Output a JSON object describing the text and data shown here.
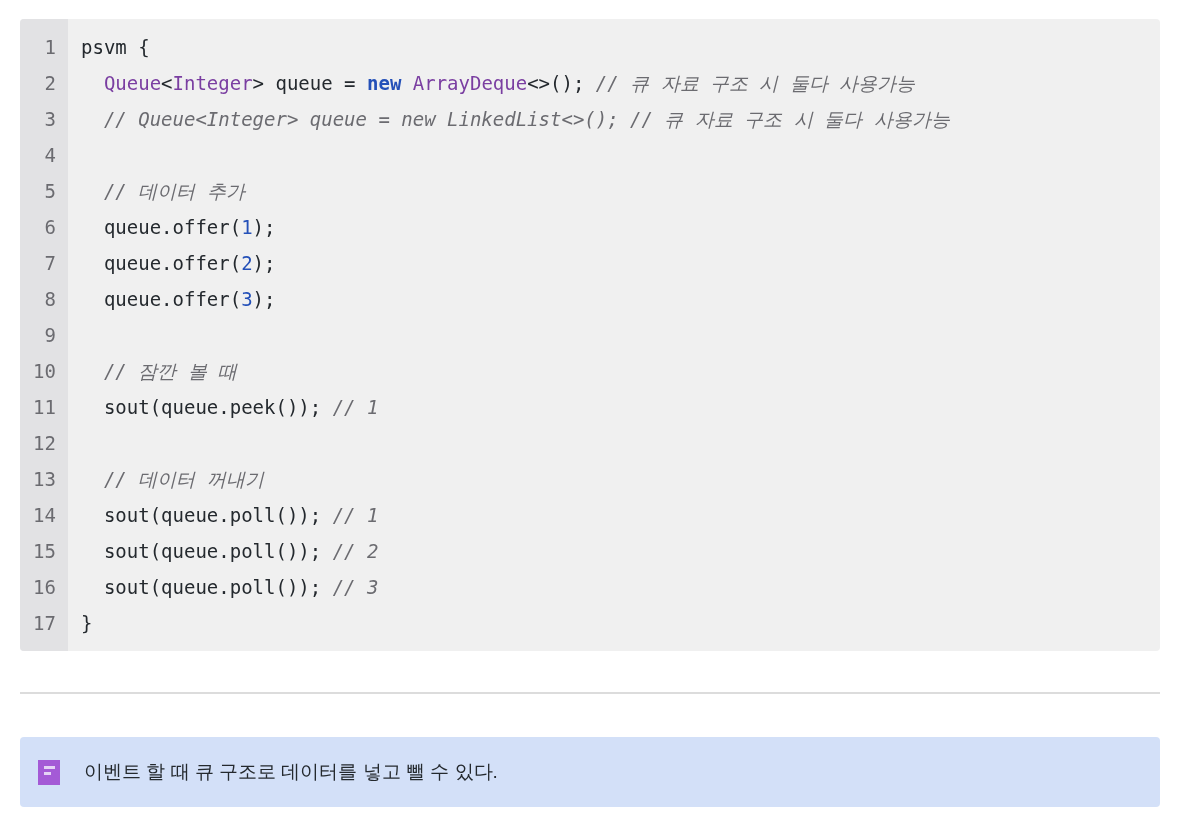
{
  "code_block": {
    "lines": [
      {
        "number": "1",
        "tokens": [
          {
            "kind": "plain",
            "text": "psvm {"
          }
        ]
      },
      {
        "number": "2",
        "tokens": [
          {
            "kind": "type",
            "text": "  Queue"
          },
          {
            "kind": "plain",
            "text": "<"
          },
          {
            "kind": "type",
            "text": "Integer"
          },
          {
            "kind": "plain",
            "text": "> queue = "
          },
          {
            "kind": "keyword",
            "text": "new"
          },
          {
            "kind": "type",
            "text": " ArrayDeque"
          },
          {
            "kind": "plain",
            "text": "<>(); "
          },
          {
            "kind": "comment",
            "text": "// 큐 자료 구조 시 둘다 사용가능"
          }
        ]
      },
      {
        "number": "3",
        "tokens": [
          {
            "kind": "comment",
            "text": "  // Queue<Integer> queue = new LinkedList<>(); // 큐 자료 구조 시 둘다 사용가능"
          }
        ]
      },
      {
        "number": "4"
      },
      {
        "number": "5",
        "tokens": [
          {
            "kind": "comment",
            "text": "  // 데이터 추가"
          }
        ]
      },
      {
        "number": "6",
        "tokens": [
          {
            "kind": "plain",
            "text": "  queue.offer("
          },
          {
            "kind": "number",
            "text": "1"
          },
          {
            "kind": "plain",
            "text": ");"
          }
        ]
      },
      {
        "number": "7",
        "tokens": [
          {
            "kind": "plain",
            "text": "  queue.offer("
          },
          {
            "kind": "number",
            "text": "2"
          },
          {
            "kind": "plain",
            "text": ");"
          }
        ]
      },
      {
        "number": "8",
        "tokens": [
          {
            "kind": "plain",
            "text": "  queue.offer("
          },
          {
            "kind": "number",
            "text": "3"
          },
          {
            "kind": "plain",
            "text": ");"
          }
        ]
      },
      {
        "number": "9"
      },
      {
        "number": "10",
        "tokens": [
          {
            "kind": "comment",
            "text": "  // 잠깐 볼 때"
          }
        ]
      },
      {
        "number": "11",
        "tokens": [
          {
            "kind": "plain",
            "text": "  sout(queue.peek()); "
          },
          {
            "kind": "comment",
            "text": "// 1"
          }
        ]
      },
      {
        "number": "12"
      },
      {
        "number": "13",
        "tokens": [
          {
            "kind": "comment",
            "text": "  // 데이터 꺼내기"
          }
        ]
      },
      {
        "number": "14",
        "tokens": [
          {
            "kind": "plain",
            "text": "  sout(queue.poll()); "
          },
          {
            "kind": "comment",
            "text": "// 1"
          }
        ]
      },
      {
        "number": "15",
        "tokens": [
          {
            "kind": "plain",
            "text": "  sout(queue.poll()); "
          },
          {
            "kind": "comment",
            "text": "// 2"
          }
        ]
      },
      {
        "number": "16",
        "tokens": [
          {
            "kind": "plain",
            "text": "  sout(queue.poll()); "
          },
          {
            "kind": "comment",
            "text": "// 3"
          }
        ]
      },
      {
        "number": "17",
        "tokens": [
          {
            "kind": "plain",
            "text": "}"
          }
        ]
      }
    ]
  },
  "callout": {
    "text": "이벤트 할 때 큐 구조로 데이터를 넣고 뺄 수 있다."
  }
}
